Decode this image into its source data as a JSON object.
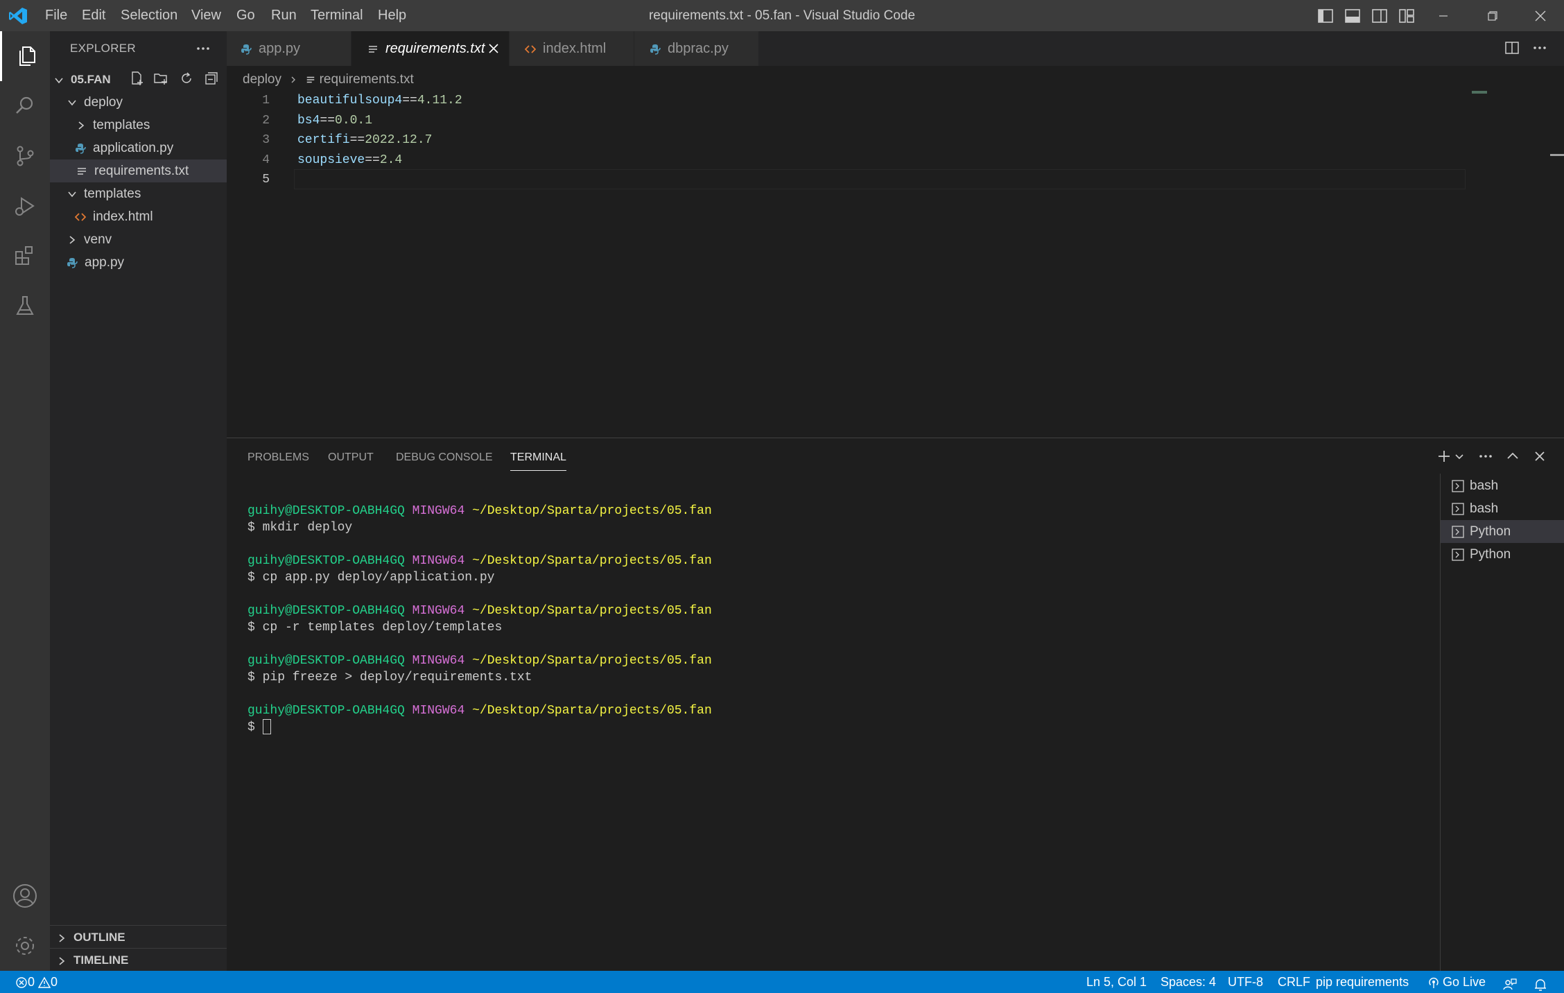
{
  "titlebar": {
    "title": "requirements.txt - 05.fan - Visual Studio Code",
    "menus": [
      "File",
      "Edit",
      "Selection",
      "View",
      "Go",
      "Run",
      "Terminal",
      "Help"
    ]
  },
  "explorer": {
    "title": "EXPLORER",
    "root": "05.FAN",
    "tree": {
      "deploy": "deploy",
      "deploy_templates": "templates",
      "application": "application.py",
      "requirements": "requirements.txt",
      "templates": "templates",
      "index": "index.html",
      "venv": "venv",
      "app": "app.py"
    },
    "outline": "OUTLINE",
    "timeline": "TIMELINE"
  },
  "tabs": [
    "app.py",
    "requirements.txt",
    "index.html",
    "dbprac.py"
  ],
  "breadcrumb": {
    "folder": "deploy",
    "file": "requirements.txt"
  },
  "editor": {
    "lines": [
      {
        "num": "1",
        "pkg": "beautifulsoup4",
        "op": "==",
        "ver": "4.11.2"
      },
      {
        "num": "2",
        "pkg": "bs4",
        "op": "==",
        "ver": "0.0.1"
      },
      {
        "num": "3",
        "pkg": "certifi",
        "op": "==",
        "ver": "2022.12.7"
      },
      {
        "num": "4",
        "pkg": "soupsieve",
        "op": "==",
        "ver": "2.4"
      },
      {
        "num": "5",
        "pkg": "",
        "op": "",
        "ver": ""
      }
    ]
  },
  "panel": {
    "tabs": [
      "PROBLEMS",
      "OUTPUT",
      "DEBUG CONSOLE",
      "TERMINAL"
    ],
    "prompt": {
      "user": "guihy@DESKTOP-OABH4GQ",
      "shell": "MINGW64",
      "path": "~/Desktop/Sparta/projects/05.fan"
    },
    "commands": [
      "$ mkdir deploy",
      "$ cp app.py deploy/application.py",
      "$ cp -r templates deploy/templates",
      "$ pip freeze > deploy/requirements.txt",
      "$ "
    ],
    "terminals": [
      "bash",
      "bash",
      "Python",
      "Python"
    ]
  },
  "statusbar": {
    "errors": "0",
    "warnings": "0",
    "position": "Ln 5, Col 1",
    "spaces": "Spaces: 4",
    "encoding": "UTF-8",
    "eol": "CRLF",
    "language": "pip requirements",
    "golive": "Go Live"
  },
  "colors": {
    "accent": "#007acc",
    "prompt_user": "#23d18b",
    "prompt_shell": "#d670d6",
    "prompt_path": "#f5f543"
  }
}
